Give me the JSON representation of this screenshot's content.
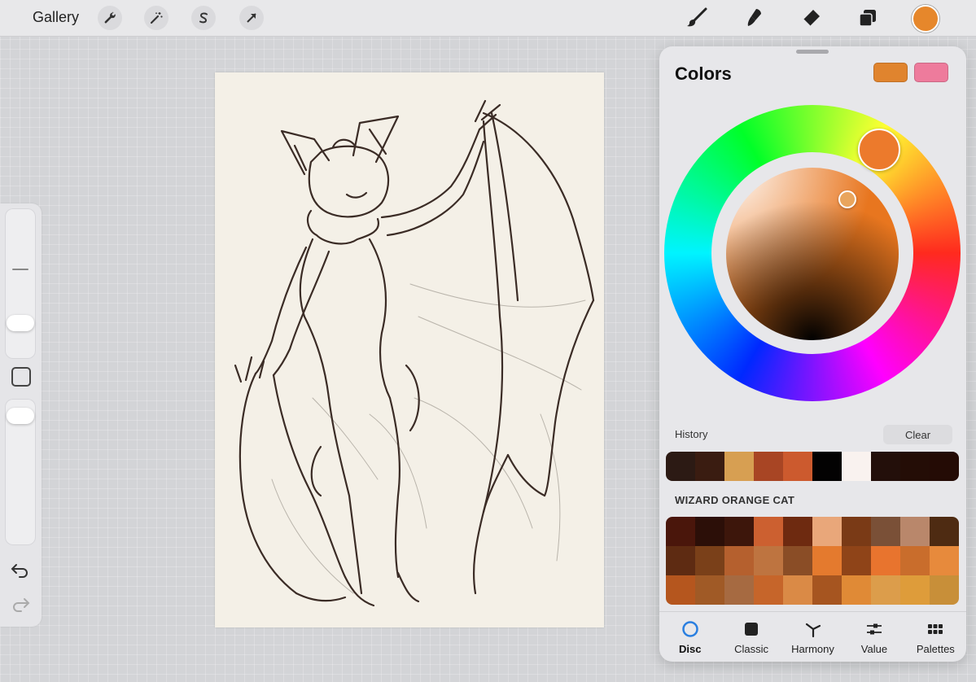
{
  "toolbar": {
    "gallery_label": "Gallery",
    "left_tools": [
      "wrench-icon",
      "magic-wand-icon",
      "selection-s-icon",
      "transform-arrow-icon"
    ],
    "right_tools": [
      "brush-icon",
      "smudge-icon",
      "eraser-icon",
      "layers-icon"
    ],
    "current_color": "#e6872b"
  },
  "sidebar": {
    "undo_icon": "undo-arrow-icon",
    "redo_icon": "redo-arrow-icon",
    "modifier_icon": "square-modifier-icon"
  },
  "panel": {
    "title": "Colors",
    "primary_color": "#e0842e",
    "secondary_color": "#ee7b9c",
    "history_label": "History",
    "clear_label": "Clear",
    "history_colors": [
      "#2c1a14",
      "#3a1c11",
      "#d79f52",
      "#a84524",
      "#cc5a2e",
      "#030202",
      "#f9f2ef",
      "#230f0a",
      "#240d06",
      "#240b05"
    ],
    "palette_name": "WIZARD ORANGE CAT",
    "palette_colors": [
      "#4a160b",
      "#2c0f08",
      "#3d160b",
      "#cc6030",
      "#6e2a10",
      "#e9a77a",
      "#7a3a16",
      "#7a5037",
      "#b9876b",
      "#4e2b12",
      "#5e2b12",
      "#7a4019",
      "#b5602e",
      "#be7440",
      "#8a4d26",
      "#e47a2e",
      "#8f4418",
      "#e8742e",
      "#c96d2c",
      "#e78a3c",
      "#b5561e",
      "#a05a26",
      "#a66a41",
      "#c6652a",
      "#da8a46",
      "#a65520",
      "#e08a36",
      "#dc9d4b",
      "#de9c3a",
      "#c88f39"
    ],
    "tabs": [
      {
        "label": "Disc",
        "icon": "disc-circle-icon",
        "active": true
      },
      {
        "label": "Classic",
        "icon": "classic-square-icon",
        "active": false
      },
      {
        "label": "Harmony",
        "icon": "harmony-icon",
        "active": false
      },
      {
        "label": "Value",
        "icon": "value-sliders-icon",
        "active": false
      },
      {
        "label": "Palettes",
        "icon": "palettes-grid-icon",
        "active": false
      }
    ]
  }
}
